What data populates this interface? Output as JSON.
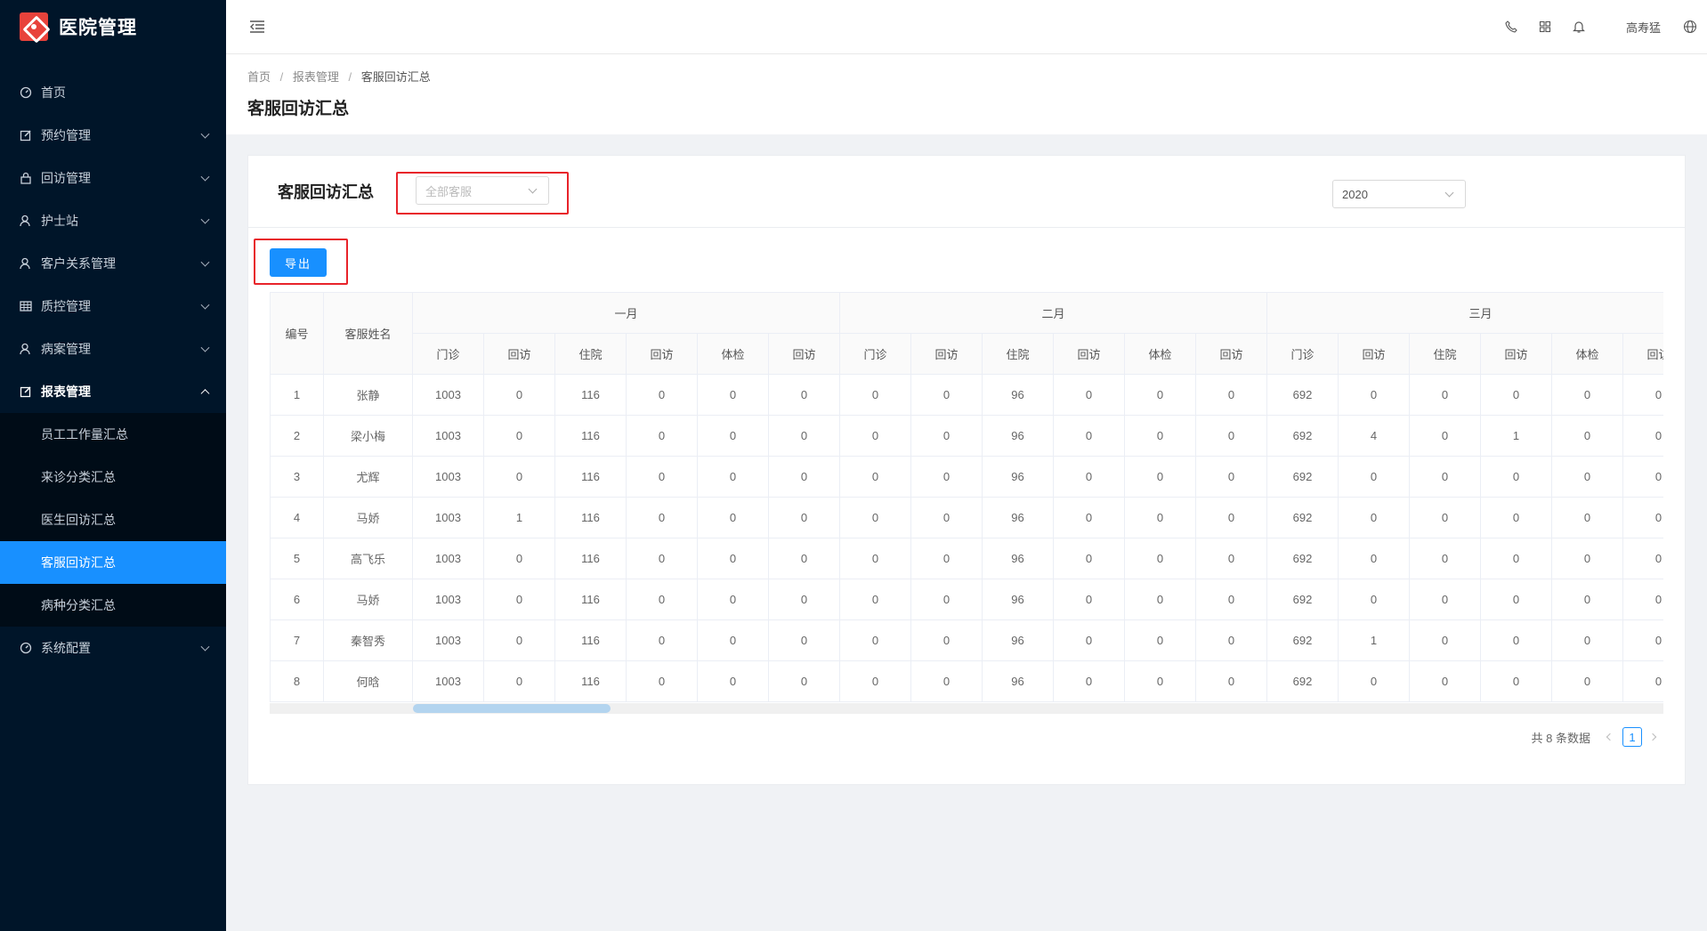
{
  "app": {
    "title": "医院管理"
  },
  "sidebar": {
    "items": [
      {
        "label": "首页",
        "icon": "dashboard-icon",
        "expandable": false
      },
      {
        "label": "预约管理",
        "icon": "edit-icon",
        "expandable": true
      },
      {
        "label": "回访管理",
        "icon": "lock-icon",
        "expandable": true
      },
      {
        "label": "护士站",
        "icon": "user-icon",
        "expandable": true
      },
      {
        "label": "客户关系管理",
        "icon": "user-icon",
        "expandable": true
      },
      {
        "label": "质控管理",
        "icon": "table-icon",
        "expandable": true
      },
      {
        "label": "病案管理",
        "icon": "user-icon",
        "expandable": true
      },
      {
        "label": "报表管理",
        "icon": "edit-icon",
        "expandable": true,
        "open": true
      }
    ],
    "report_submenu": [
      "员工工作量汇总",
      "来诊分类汇总",
      "医生回访汇总",
      "客服回访汇总",
      "病种分类汇总"
    ],
    "active_sub": "客服回访汇总",
    "last_item": {
      "label": "系统配置",
      "icon": "dashboard-icon"
    }
  },
  "header": {
    "user": "高寿猛",
    "icons": [
      "phone-icon",
      "apps-icon",
      "bell-icon",
      "globe-icon"
    ]
  },
  "breadcrumb": [
    "首页",
    "报表管理",
    "客服回访汇总"
  ],
  "page_title": "客服回访汇总",
  "card": {
    "title": "客服回访汇总",
    "kefu_select_placeholder": "全部客服",
    "year_select_value": "2020",
    "export_label": "导出"
  },
  "table": {
    "col_id": "编号",
    "col_name": "客服姓名",
    "months": [
      "一月",
      "二月",
      "三月"
    ],
    "sub_cols": [
      "门诊",
      "回访",
      "住院",
      "回访",
      "体检",
      "回访"
    ],
    "rows": [
      {
        "id": "1",
        "name": "张静",
        "v": [
          "1003",
          "0",
          "116",
          "0",
          "0",
          "0",
          "0",
          "0",
          "96",
          "0",
          "0",
          "0",
          "692",
          "0",
          "0",
          "0",
          "0",
          "0"
        ]
      },
      {
        "id": "2",
        "name": "梁小梅",
        "v": [
          "1003",
          "0",
          "116",
          "0",
          "0",
          "0",
          "0",
          "0",
          "96",
          "0",
          "0",
          "0",
          "692",
          "4",
          "0",
          "1",
          "0",
          "0"
        ]
      },
      {
        "id": "3",
        "name": "尤辉",
        "v": [
          "1003",
          "0",
          "116",
          "0",
          "0",
          "0",
          "0",
          "0",
          "96",
          "0",
          "0",
          "0",
          "692",
          "0",
          "0",
          "0",
          "0",
          "0"
        ]
      },
      {
        "id": "4",
        "name": "马娇",
        "v": [
          "1003",
          "1",
          "116",
          "0",
          "0",
          "0",
          "0",
          "0",
          "96",
          "0",
          "0",
          "0",
          "692",
          "0",
          "0",
          "0",
          "0",
          "0"
        ]
      },
      {
        "id": "5",
        "name": "高飞乐",
        "v": [
          "1003",
          "0",
          "116",
          "0",
          "0",
          "0",
          "0",
          "0",
          "96",
          "0",
          "0",
          "0",
          "692",
          "0",
          "0",
          "0",
          "0",
          "0"
        ]
      },
      {
        "id": "6",
        "name": "马娇",
        "v": [
          "1003",
          "0",
          "116",
          "0",
          "0",
          "0",
          "0",
          "0",
          "96",
          "0",
          "0",
          "0",
          "692",
          "0",
          "0",
          "0",
          "0",
          "0"
        ]
      },
      {
        "id": "7",
        "name": "秦智秀",
        "v": [
          "1003",
          "0",
          "116",
          "0",
          "0",
          "0",
          "0",
          "0",
          "96",
          "0",
          "0",
          "0",
          "692",
          "1",
          "0",
          "0",
          "0",
          "0"
        ]
      },
      {
        "id": "8",
        "name": "何晗",
        "v": [
          "1003",
          "0",
          "116",
          "0",
          "0",
          "0",
          "0",
          "0",
          "96",
          "0",
          "0",
          "0",
          "692",
          "0",
          "0",
          "0",
          "0",
          "0"
        ]
      }
    ]
  },
  "pagination": {
    "total_text": "共 8 条数据",
    "current": "1"
  }
}
